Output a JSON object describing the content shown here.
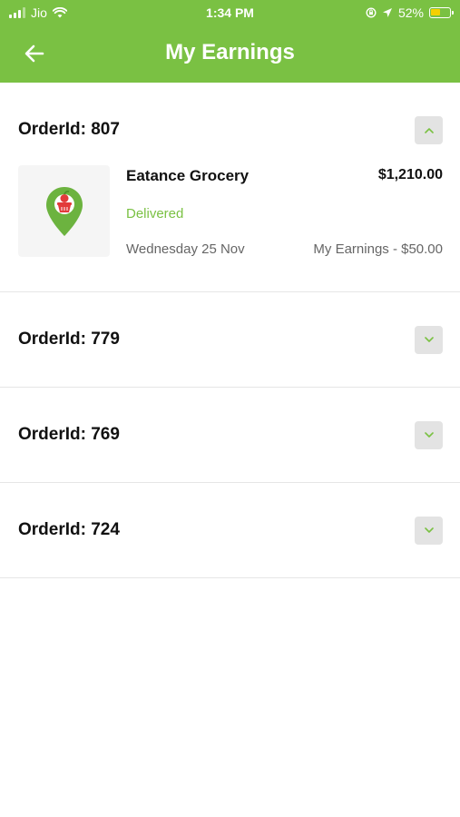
{
  "status_bar": {
    "carrier": "Jio",
    "time": "1:34 PM",
    "battery_percent": "52%",
    "battery_level": 0.52
  },
  "header": {
    "title": "My Earnings",
    "back_icon": "arrow-left-icon"
  },
  "colors": {
    "brand": "#7ac143",
    "status_delivered": "#7ac143",
    "toggle_bg": "#e3e3e3"
  },
  "orders": [
    {
      "order_id": "OrderId: 807",
      "expanded": true,
      "store_name": "Eatance Grocery",
      "amount": "$1,210.00",
      "status": "Delivered",
      "date": "Wednesday 25 Nov",
      "earnings": "My Earnings - $50.00",
      "icon": "store-pin-icon"
    },
    {
      "order_id": "OrderId: 779",
      "expanded": false
    },
    {
      "order_id": "OrderId: 769",
      "expanded": false
    },
    {
      "order_id": "OrderId: 724",
      "expanded": false
    }
  ]
}
